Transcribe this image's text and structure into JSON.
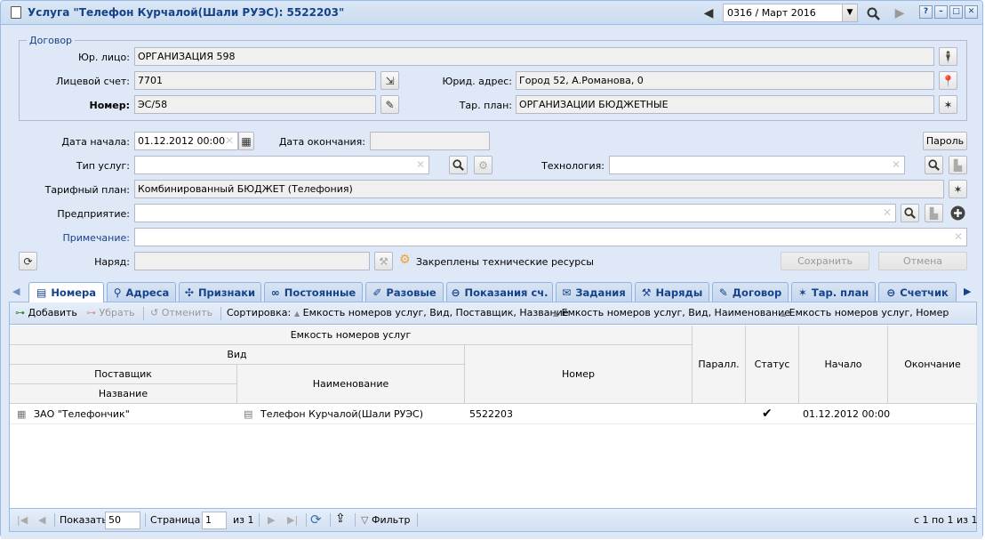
{
  "window": {
    "title": "Услуга \"Телефон Курчалой(Шали РУЭС): 5522203\"",
    "period": "0316 / Март 2016",
    "help": "?"
  },
  "contract": {
    "legend": "Договор",
    "legal_entity_label": "Юр. лицо:",
    "legal_entity": "ОРГАНИЗАЦИЯ 598",
    "account_label": "Лицевой счет:",
    "account": "7701",
    "legal_address_label": "Юрид. адрес:",
    "legal_address": "Город 52, А.Романова, 0",
    "number_label": "Номер:",
    "number": "ЭС/58",
    "tariff_label": "Тар. план:",
    "tariff": "ОРГАНИЗАЦИИ БЮДЖЕТНЫЕ"
  },
  "form": {
    "start_date_label": "Дата начала:",
    "start_date": "01.12.2012 00:00",
    "end_date_label": "Дата окончания:",
    "end_date": "",
    "password_button": "Пароль",
    "service_type_label": "Тип услуг:",
    "service_type": "",
    "technology_label": "Технология:",
    "technology": "",
    "tariff_plan_label": "Тарифный план:",
    "tariff_plan": "Комбинированный БЮДЖЕТ (Телефония)",
    "enterprise_label": "Предприятие:",
    "enterprise": "",
    "note_label": "Примечание:",
    "note": "",
    "order_label": "Наряд:",
    "order": "",
    "tech_resources": "Закреплены технические ресурсы",
    "save_button": "Сохранить",
    "cancel_button": "Отмена"
  },
  "tabs": [
    {
      "label": "Номера",
      "icon": "phone-list-icon",
      "active": true
    },
    {
      "label": "Адреса",
      "icon": "map-pin-icon"
    },
    {
      "label": "Признаки",
      "icon": "tags-icon"
    },
    {
      "label": "Постоянные",
      "icon": "link-icon"
    },
    {
      "label": "Разовые",
      "icon": "wrench-icon"
    },
    {
      "label": "Показания сч.",
      "icon": "minus-circle-icon"
    },
    {
      "label": "Задания",
      "icon": "scroll-icon"
    },
    {
      "label": "Наряды",
      "icon": "tools-icon"
    },
    {
      "label": "Договор",
      "icon": "edit-icon"
    },
    {
      "label": "Тар. план",
      "icon": "network-icon"
    },
    {
      "label": "Счетчик",
      "icon": "minus-circle-icon"
    }
  ],
  "toolbar": {
    "add": "Добавить",
    "remove": "Убрать",
    "undo": "Отменить",
    "sort_label": "Сортировка:",
    "sort1": "Емкость номеров услуг, Вид, Поставщик, Название",
    "sort2": "Емкость номеров услуг, Вид, Наименование",
    "sort3": "Емкость номеров услуг, Номер"
  },
  "grid": {
    "group_header": "Емкость номеров услуг",
    "type_header": "Вид",
    "supplier_header": "Поставщик",
    "name_header": "Название",
    "title_header": "Наименование",
    "number_header": "Номер",
    "parallel_header": "Паралл.",
    "status_header": "Статус",
    "start_header": "Начало",
    "end_header": "Окончание",
    "rows": [
      {
        "supplier": "ЗАО \"Телефончик\"",
        "title": "Телефон Курчалой(Шали РУЭС)",
        "number": "5522203",
        "parallel": "",
        "status": "✔",
        "start": "01.12.2012 00:00",
        "end": ""
      }
    ]
  },
  "pager": {
    "show_label": "Показать",
    "page_size": "50",
    "page_label": "Страница",
    "page": "1",
    "of_label": "из 1",
    "filter": "Фильтр",
    "summary": "с 1 по 1 из 1"
  }
}
